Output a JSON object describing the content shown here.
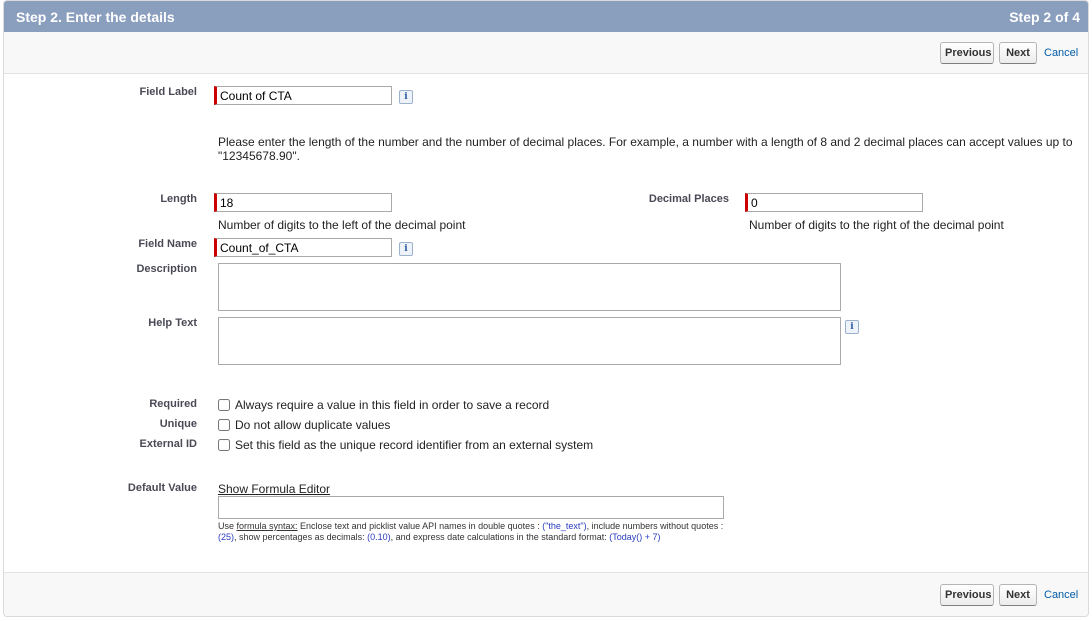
{
  "header": {
    "title": "Step 2. Enter the details",
    "step": "Step 2 of 4"
  },
  "buttons": {
    "previous": "Previous",
    "next": "Next",
    "cancel": "Cancel"
  },
  "fields": {
    "field_label": {
      "label": "Field Label",
      "value": "Count of CTA"
    },
    "instructions": "Please enter the length of the number and the number of decimal places. For example, a number with a length of 8 and 2 decimal places can accept values up to \"12345678.90\".",
    "length": {
      "label": "Length",
      "value": "18",
      "help": "Number of digits to the left of the decimal point"
    },
    "decimal_places": {
      "label": "Decimal Places",
      "value": "0",
      "help": "Number of digits to the right of the decimal point"
    },
    "field_name": {
      "label": "Field Name",
      "value": "Count_of_CTA"
    },
    "description": {
      "label": "Description",
      "value": ""
    },
    "help_text": {
      "label": "Help Text",
      "value": ""
    },
    "required": {
      "label": "Required",
      "text": "Always require a value in this field in order to save a record",
      "checked": false
    },
    "unique": {
      "label": "Unique",
      "text": "Do not allow duplicate values",
      "checked": false
    },
    "external_id": {
      "label": "External ID",
      "text": "Set this field as the unique record identifier from an external system",
      "checked": false
    },
    "default_value": {
      "label": "Default Value",
      "link": "Show Formula Editor",
      "value": "",
      "hint": {
        "use": "Use ",
        "syntax_link": "formula syntax:",
        "part1": " Enclose text and picklist value API names in double quotes : ",
        "ex1": "(\"the_text\")",
        "part2": ", include numbers without quotes : ",
        "ex2": "(25)",
        "part3": ", show percentages as decimals: ",
        "ex3": "(0.10)",
        "part4": ", and express date calculations in the standard format: ",
        "ex4": "(Today() + 7)"
      }
    }
  },
  "icons": {
    "info": "i"
  },
  "colors": {
    "header_bg": "#8a9ebe",
    "required_marker": "#cc0000",
    "link": "#015ba7"
  }
}
